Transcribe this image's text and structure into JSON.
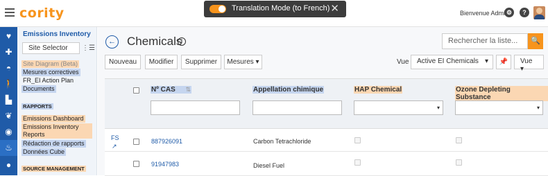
{
  "app": {
    "logo": "cority",
    "welcome": "Bienvenue Admin",
    "help_icon_glyph": "?"
  },
  "toast": {
    "text": "Translation Mode (to French)",
    "close_glyph": "✕",
    "accent": "#f7941d"
  },
  "sidebar": {
    "title": "Emissions Inventory",
    "site_selector": "Site Selector",
    "items": [
      {
        "label": "Site Diagram (Beta)",
        "highlight": "orange"
      },
      {
        "label": "Mesures correctives",
        "highlight": "blue"
      },
      {
        "label": "FR_EI Action Plan",
        "highlight": "none"
      },
      {
        "label": "Documents",
        "highlight": "blue"
      }
    ],
    "section_rapports": "RAPPORTS",
    "report_items": [
      {
        "label": "Emissions Dashboard",
        "highlight": "orange"
      },
      {
        "label": "Emissions Inventory",
        "highlight": "orange"
      },
      {
        "label": "Reports",
        "highlight": "orange"
      },
      {
        "label": "Rédaction de rapports",
        "highlight": "blue"
      },
      {
        "label": "Données Cube",
        "highlight": "blue"
      }
    ],
    "section_source": "SOURCE MANAGEMENT"
  },
  "page": {
    "title": "Chemicals",
    "search_placeholder": "Rechercher la liste...",
    "toolbar": {
      "new_label": "Nouveau",
      "edit_label": "Modifier",
      "delete_label": "Supprimer",
      "measures_label": "Mesures",
      "view_label": "Vue",
      "view_selected": "Active EI Chemicals",
      "view_button": "Vue"
    }
  },
  "table": {
    "columns": [
      "Nº CAS",
      "Appellation chimique",
      "HAP Chemical",
      "Ozone Depleting Substance"
    ],
    "rows": [
      {
        "prefix": "FS",
        "cas": "887926091",
        "name": "Carbon Tetrachloride"
      },
      {
        "prefix": "",
        "cas": "91947983",
        "name": "Diesel Fuel"
      }
    ]
  }
}
